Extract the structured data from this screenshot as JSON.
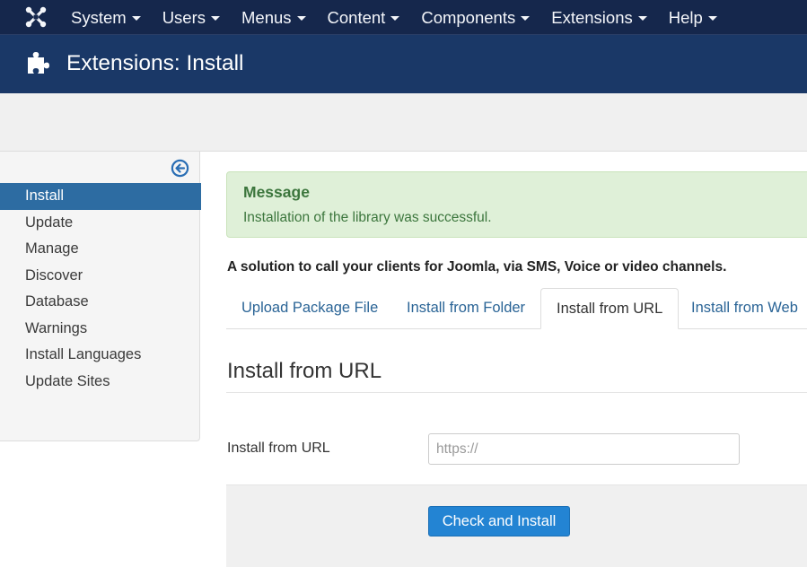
{
  "topnav": {
    "items": [
      {
        "label": "System"
      },
      {
        "label": "Users"
      },
      {
        "label": "Menus"
      },
      {
        "label": "Content"
      },
      {
        "label": "Components"
      },
      {
        "label": "Extensions"
      },
      {
        "label": "Help"
      }
    ]
  },
  "header": {
    "title": "Extensions: Install"
  },
  "sidebar": {
    "items": [
      {
        "label": "Install",
        "active": true
      },
      {
        "label": "Update"
      },
      {
        "label": "Manage"
      },
      {
        "label": "Discover"
      },
      {
        "label": "Database"
      },
      {
        "label": "Warnings"
      },
      {
        "label": "Install Languages"
      },
      {
        "label": "Update Sites"
      }
    ]
  },
  "alert": {
    "heading": "Message",
    "text": "Installation of the library was successful."
  },
  "description": "A solution to call your clients for Joomla, via SMS, Voice or video channels.",
  "tabs": [
    {
      "label": "Upload Package File"
    },
    {
      "label": "Install from Folder"
    },
    {
      "label": "Install from URL",
      "active": true
    },
    {
      "label": "Install from Web"
    }
  ],
  "panel": {
    "title": "Install from URL",
    "field_label": "Install from URL",
    "input_placeholder": "https://",
    "input_value": "",
    "button_label": "Check and Install"
  },
  "colors": {
    "nav_bg": "#15274c",
    "header_bg": "#1a3867",
    "sidebar_active": "#2d6ca2",
    "alert_bg": "#dff0d8",
    "alert_text": "#3c763d",
    "link": "#2a6496",
    "button": "#2384d3"
  },
  "icons": {
    "logo": "joomla-logo",
    "header": "puzzle-piece-icon",
    "sidebar_toggle": "arrow-circle-left-icon"
  }
}
